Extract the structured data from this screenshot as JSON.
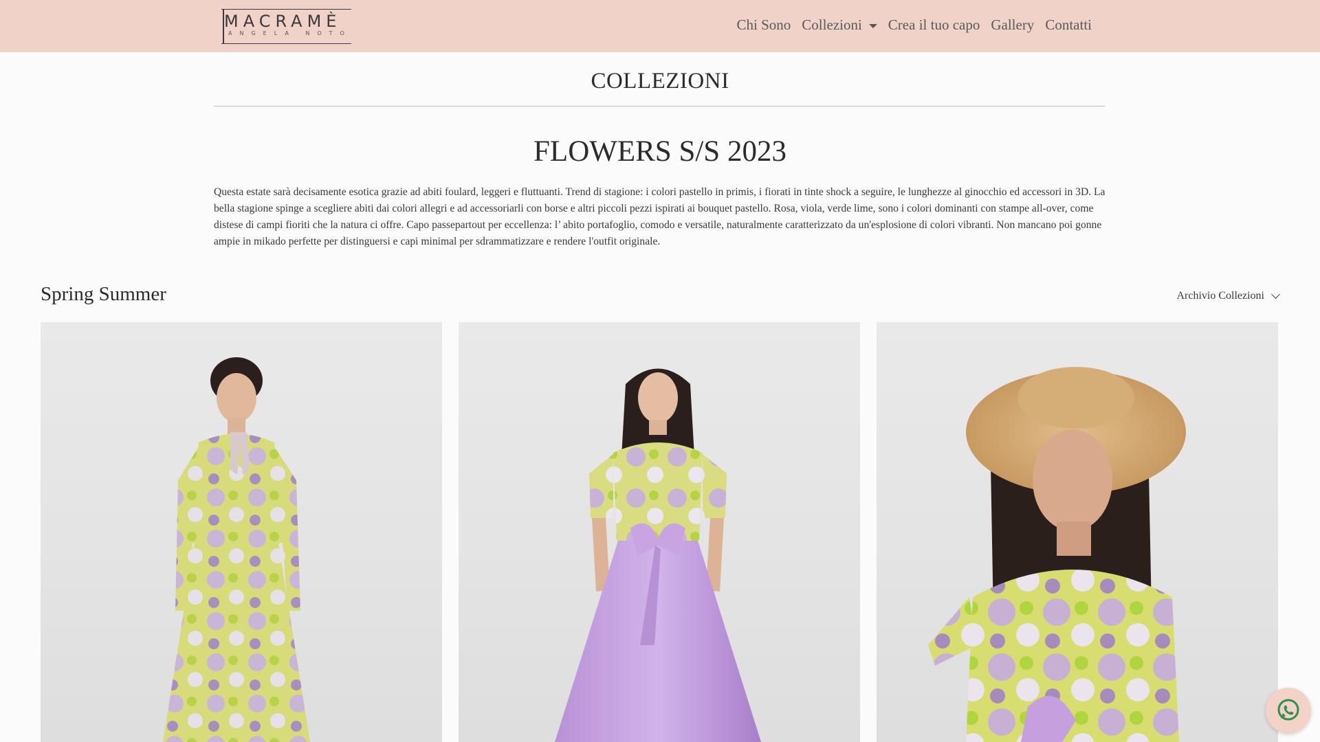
{
  "brand": {
    "name": "MACRAMÈ",
    "subtitle": "ANGELA NOTO"
  },
  "nav": {
    "items": [
      {
        "label": "Chi Sono",
        "has_dropdown": false
      },
      {
        "label": "Collezioni",
        "has_dropdown": true
      },
      {
        "label": "Crea il tuo capo",
        "has_dropdown": false
      },
      {
        "label": "Gallery",
        "has_dropdown": false
      },
      {
        "label": "Contatti",
        "has_dropdown": false
      }
    ]
  },
  "page": {
    "section_title": "COLLEZIONI",
    "collection_title": "FLOWERS S/S 2023",
    "collection_description": "Questa estate sarà decisamente esotica grazie ad abiti foulard, leggeri e fluttuanti. Trend di stagione: i colori pastello in primis, i fiorati in tinte shock a seguire, le lunghezze al ginocchio ed accessori in 3D. La bella stagione spinge a scegliere abiti dai colori allegri e ad accessoriarli con borse e altri piccoli pezzi ispirati ai bouquet pastello. Rosa, viola, verde lime, sono i colori dominanti con stampe all-over, come distese di campi fioriti che la natura ci offre. Capo passepartout per eccellenza: l’ abito portafoglio, comodo e versatile, naturalmente caratterizzato da un'esplosione di colori vibranti. Non mancano poi gonne ampie in mikado perfette per distinguersi e capi minimal per sdrammatizzare e rendere l'outfit originale."
  },
  "season": {
    "title": "Spring Summer",
    "archive_label": "Archivio Collezioni"
  },
  "gallery": {
    "items": [
      {
        "icon": "dress-photo"
      },
      {
        "icon": "skirt-outfit-photo"
      },
      {
        "icon": "hat-portrait-photo"
      }
    ]
  },
  "colors": {
    "header_bg": "#f0d2c8",
    "text": "#2b2b2b",
    "nav_text": "#5a5a5a",
    "whatsapp": "#2f8f4e"
  },
  "icons": {
    "collezioni_dropdown": "caret-down-icon",
    "archive_dropdown": "chevron-down-icon",
    "whatsapp": "whatsapp-icon"
  }
}
